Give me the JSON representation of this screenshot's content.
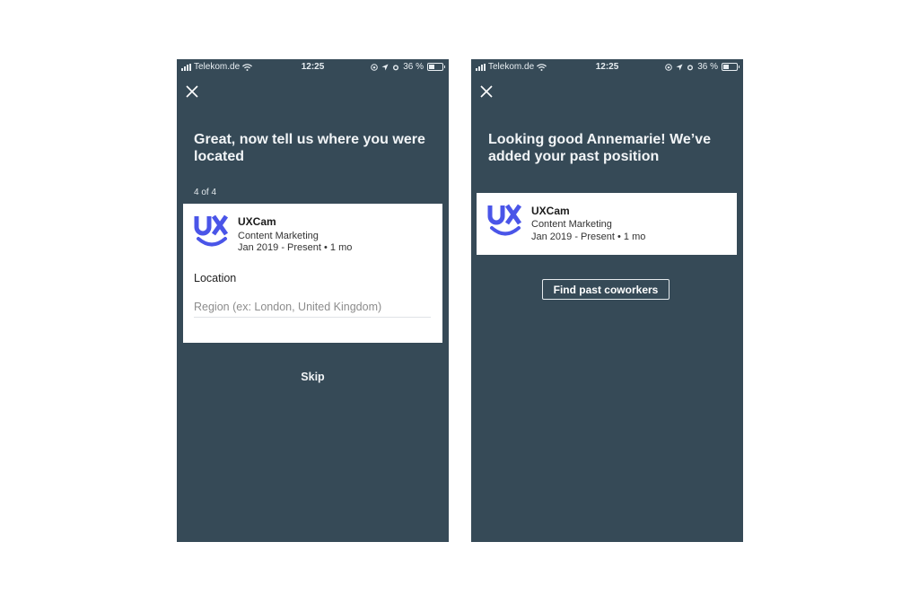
{
  "status_bar": {
    "carrier": "Telekom.de",
    "time": "12:25",
    "battery_label": "36 %",
    "battery_level_percent": 36,
    "icons": [
      "signal-icon",
      "wifi-icon",
      "lock-rotation-icon",
      "location-icon",
      "alarm-icon",
      "battery-icon"
    ]
  },
  "left_screen": {
    "close_icon": "×",
    "headline": "Great, now tell us where you were located",
    "step": "4 of 4",
    "card": {
      "logo": "uxcam-logo",
      "company": "UXCam",
      "role": "Content Marketing",
      "dates": "Jan 2019 - Present • 1 mo",
      "location_label": "Location",
      "region_value": "",
      "region_placeholder": "Region (ex: London, United Kingdom)"
    },
    "skip_label": "Skip"
  },
  "right_screen": {
    "close_icon": "×",
    "headline": "Looking good Annemarie! We’ve added your past position",
    "card": {
      "logo": "uxcam-logo",
      "company": "UXCam",
      "role": "Content Marketing",
      "dates": "Jan 2019 - Present • 1 mo"
    },
    "find_button_label": "Find past coworkers"
  },
  "colors": {
    "screen_background": "#364a57",
    "brand_logo": "#4a55e8",
    "card_background": "#ffffff"
  }
}
